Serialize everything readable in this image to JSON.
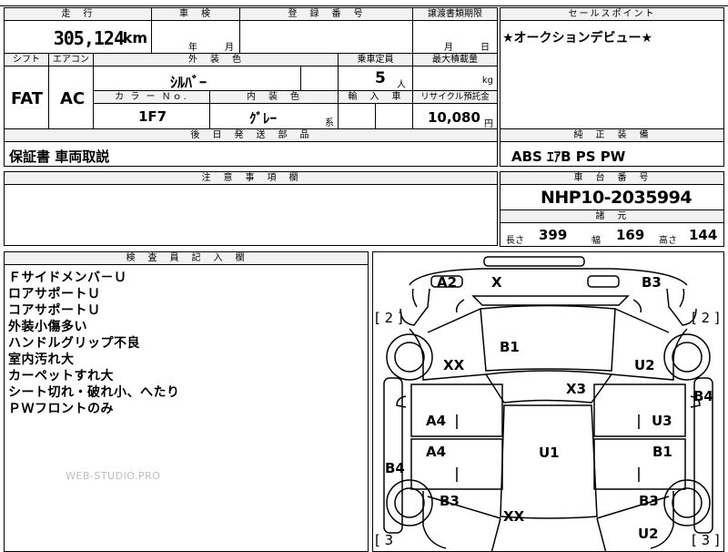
{
  "header": {
    "mileage_label": "走　行",
    "inspection_label": "車　検",
    "registration_label": "登　録　番　号",
    "transfer_deadline_label": "譲渡書類期限",
    "sales_point_label": "セールスポイント"
  },
  "vehicle": {
    "mileage": "305,124",
    "mileage_unit": "km",
    "inspection_year_unit": "年",
    "inspection_month_unit": "月",
    "transfer_month_unit": "月",
    "transfer_day_unit": "日",
    "shift_label": "シフト",
    "aircon_label": "エアコン",
    "exterior_color_label": "外　装　色",
    "capacity_label": "乗車定員",
    "max_load_label": "最大積載量",
    "shift": "FAT",
    "aircon": "AC",
    "exterior_color": "ｼﾙﾊﾞｰ",
    "capacity": "5",
    "capacity_unit": "人",
    "max_load_unit": "kg",
    "color_no_label": "カ ラ ー Ｎｏ.",
    "interior_color_label": "内　装　色",
    "import_label": "輸　入　車",
    "recycle_label": "リサイクル預託金",
    "color_no": "1F7",
    "interior_color": "ｸﾞﾚｰ",
    "interior_suffix": "系",
    "recycle_fee": "10,080",
    "recycle_unit": "円"
  },
  "sales_point": {
    "text": "★オークションデビュー★"
  },
  "later_parts": {
    "label": "後　日　発　送　部　品",
    "value": "保証書 車両取説"
  },
  "equipment": {
    "label": "純　正　装　備",
    "value": "ABS ｴｱB PS PW"
  },
  "notes": {
    "label": "注　意　事　項　欄"
  },
  "chassis": {
    "label": "車　台　番　号",
    "value": "NHP10-2035994"
  },
  "specs": {
    "label": "諸　元",
    "length_label": "長さ",
    "length": "399",
    "width_label": "幅",
    "width": "169",
    "height_label": "高さ",
    "height": "144"
  },
  "inspector": {
    "label": "検　査　員　記　入　欄",
    "lines": [
      "Ｆサイドメンバ－Ｕ",
      "ロアサポートＵ",
      "コアサポートＵ",
      "外装小傷多い",
      "ハンドルグリップ不良",
      "室内汚れ大",
      "カーペットすれ大",
      "シート切れ・破れ小、へたり",
      "ＰＷフロントのみ"
    ],
    "watermark": "WEB-STUDIO.PRO"
  },
  "diagram": {
    "labels": {
      "a2": "A2",
      "x_top": "X",
      "b3_top_right": "B3",
      "bracket_left_top": "[ 2 ]",
      "bracket_right_top": "[ 2 ]",
      "b1_hood": "B1",
      "xx_left": "XX",
      "u2_right": "U2",
      "b4_right": "B4",
      "x3": "X3",
      "a4_upper": "A4",
      "u3": "U3",
      "a4_lower": "A4",
      "u1": "U1",
      "b1_right": "B1",
      "b4_left": "B4",
      "b3_left": "B3",
      "b3_right_low": "B3",
      "xx_bottom": "XX",
      "u2_bottom": "U2",
      "bracket_left_bottom": "[ 3",
      "bracket_right_bottom": "[ 3 ]"
    }
  }
}
